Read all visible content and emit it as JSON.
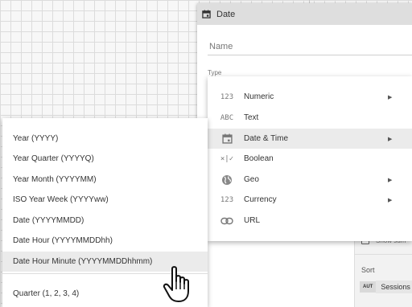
{
  "field_panel": {
    "title": "Date",
    "name_placeholder": "Name",
    "type_label": "Type",
    "show_summary_label": "Show sum",
    "sort_label": "Sort",
    "sort_chip_prefix": "AUT",
    "sort_chip_field": "Sessions"
  },
  "type_menu": {
    "items": [
      {
        "icon": "123",
        "icon_name": "numeric-icon",
        "label": "Numeric",
        "has_submenu": true
      },
      {
        "icon": "ABC",
        "icon_name": "text-icon",
        "label": "Text",
        "has_submenu": false
      },
      {
        "icon": "calendar",
        "icon_name": "calendar-icon",
        "label": "Date & Time",
        "has_submenu": true,
        "active": true
      },
      {
        "icon": "×|✓",
        "icon_name": "boolean-icon",
        "label": "Boolean",
        "has_submenu": false
      },
      {
        "icon": "globe",
        "icon_name": "globe-icon",
        "label": "Geo",
        "has_submenu": true
      },
      {
        "icon": "123",
        "icon_name": "currency-icon",
        "label": "Currency",
        "has_submenu": true
      },
      {
        "icon": "link",
        "icon_name": "link-icon",
        "label": "URL",
        "has_submenu": false
      }
    ]
  },
  "date_submenu": {
    "items": [
      "Year (YYYY)",
      "Year Quarter (YYYYQ)",
      "Year Month (YYYYMM)",
      "ISO Year Week (YYYYww)",
      "Date (YYYYMMDD)",
      "Date Hour (YYYYMMDDhh)",
      "Date Hour Minute (YYYYMMDDhhmm)"
    ],
    "hovered_index": 6,
    "after_divider": [
      "Quarter (1, 2, 3, 4)"
    ]
  },
  "colors": {
    "menu_bg": "#ffffff",
    "hover_bg": "#ebebeb",
    "header_bg": "#dedede",
    "text": "#333333",
    "icon": "#777777"
  }
}
